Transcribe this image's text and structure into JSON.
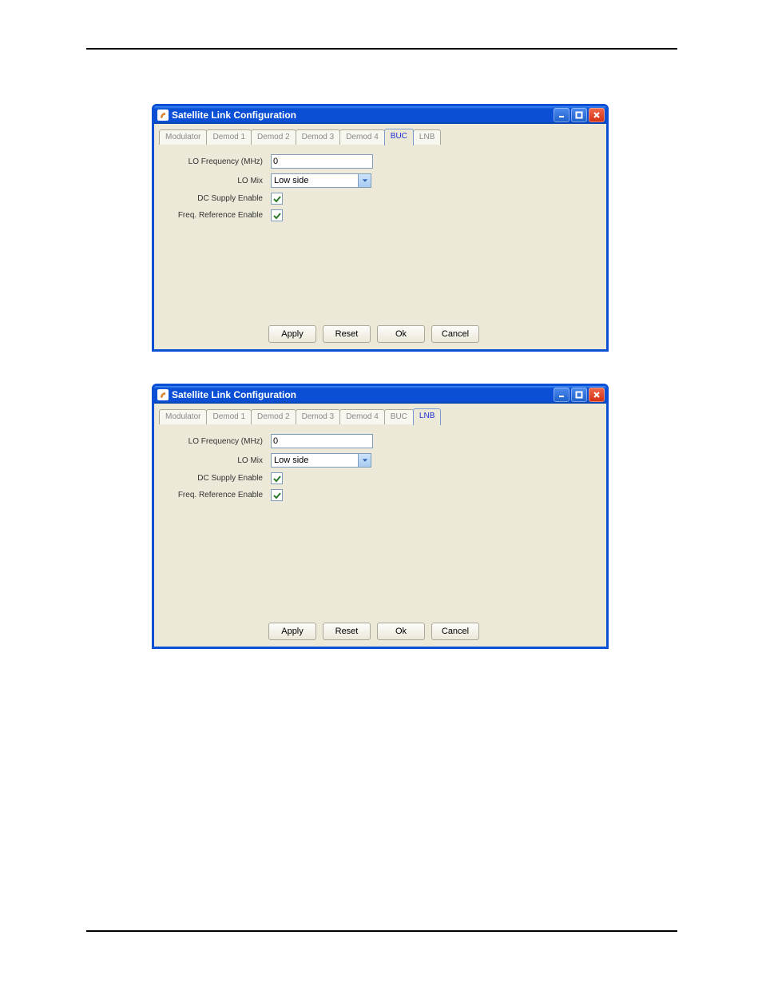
{
  "window1": {
    "title": "Satellite Link Configuration",
    "tabs": [
      "Modulator",
      "Demod 1",
      "Demod 2",
      "Demod 3",
      "Demod 4",
      "BUC",
      "LNB"
    ],
    "active_tab": "BUC",
    "fields": {
      "lo_freq_label": "LO Frequency (MHz)",
      "lo_freq_value": "0",
      "lo_mix_label": "LO Mix",
      "lo_mix_value": "Low side",
      "dc_supply_label": "DC Supply Enable",
      "freq_ref_label": "Freq. Reference Enable"
    },
    "buttons": {
      "apply": "Apply",
      "reset": "Reset",
      "ok": "Ok",
      "cancel": "Cancel"
    }
  },
  "window2": {
    "title": "Satellite Link Configuration",
    "tabs": [
      "Modulator",
      "Demod 1",
      "Demod 2",
      "Demod 3",
      "Demod 4",
      "BUC",
      "LNB"
    ],
    "active_tab": "LNB",
    "fields": {
      "lo_freq_label": "LO Frequency (MHz)",
      "lo_freq_value": "0",
      "lo_mix_label": "LO Mix",
      "lo_mix_value": "Low side",
      "dc_supply_label": "DC Supply Enable",
      "freq_ref_label": "Freq. Reference Enable"
    },
    "buttons": {
      "apply": "Apply",
      "reset": "Reset",
      "ok": "Ok",
      "cancel": "Cancel"
    }
  }
}
